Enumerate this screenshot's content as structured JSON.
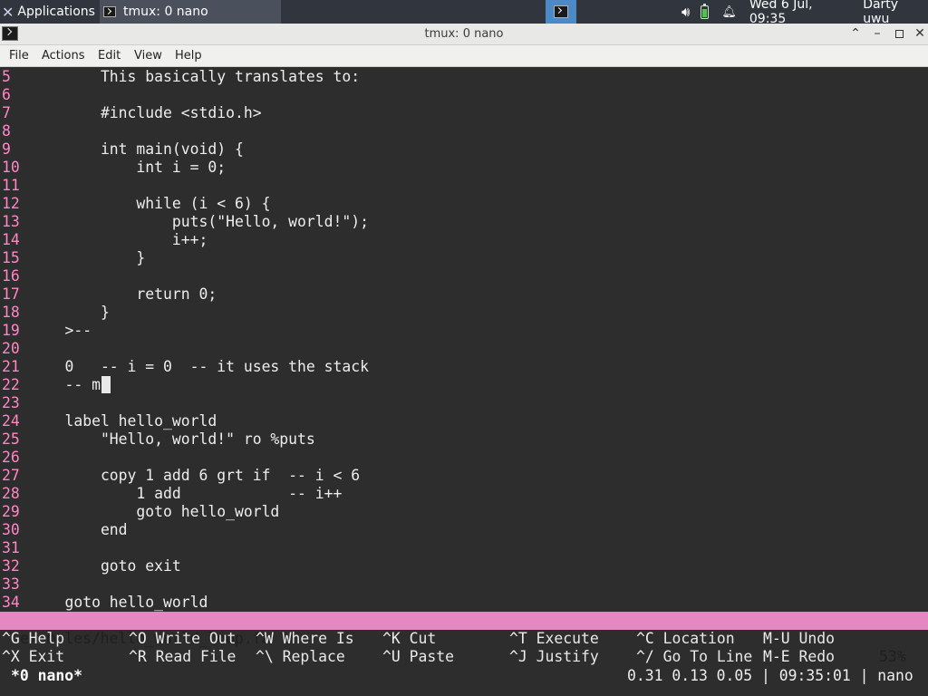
{
  "panel": {
    "applications_label": "Applications",
    "task_title": "tmux: 0 nano",
    "clock": "Wed  6 Jul, 09:35",
    "user": "Darty uwu"
  },
  "window": {
    "title": "tmux: 0 nano"
  },
  "menubar": {
    "file": "File",
    "actions": "Actions",
    "edit": "Edit",
    "view": "View",
    "help": "Help"
  },
  "editor": {
    "lines": [
      {
        "n": "5",
        "text": "        This basically translates to:"
      },
      {
        "n": "6",
        "text": ""
      },
      {
        "n": "7",
        "text": "        #include <stdio.h>"
      },
      {
        "n": "8",
        "text": ""
      },
      {
        "n": "9",
        "text": "        int main(void) {"
      },
      {
        "n": "10",
        "text": "            int i = 0;"
      },
      {
        "n": "11",
        "text": ""
      },
      {
        "n": "12",
        "text": "            while (i < 6) {"
      },
      {
        "n": "13",
        "text": "                puts(\"Hello, world!\");"
      },
      {
        "n": "14",
        "text": "                i++;"
      },
      {
        "n": "15",
        "text": "            }"
      },
      {
        "n": "16",
        "text": ""
      },
      {
        "n": "17",
        "text": "            return 0;"
      },
      {
        "n": "18",
        "text": "        }"
      },
      {
        "n": "19",
        "text": "    >--"
      },
      {
        "n": "20",
        "text": ""
      },
      {
        "n": "21",
        "text": "    0   -- i = 0  -- it uses the stack"
      },
      {
        "n": "22",
        "text": "    -- m"
      },
      {
        "n": "23",
        "text": ""
      },
      {
        "n": "24",
        "text": "    label hello_world"
      },
      {
        "n": "25",
        "text": "        \"Hello, world!\" ro %puts"
      },
      {
        "n": "26",
        "text": ""
      },
      {
        "n": "27",
        "text": "        copy 1 add 6 grt if  -- i < 6"
      },
      {
        "n": "28",
        "text": "            1 add            -- i++"
      },
      {
        "n": "29",
        "text": "            goto hello_world"
      },
      {
        "n": "30",
        "text": "        end"
      },
      {
        "n": "31",
        "text": ""
      },
      {
        "n": "32",
        "text": "        goto exit"
      },
      {
        "n": "33",
        "text": ""
      },
      {
        "n": "34",
        "text": "    goto hello_world"
      }
    ],
    "status_file": "examples/hello_world_loop.fa *",
    "status_percent": "53%"
  },
  "shortcuts": {
    "row1": [
      {
        "key": "^G",
        "label": "Help"
      },
      {
        "key": "^O",
        "label": "Write Out"
      },
      {
        "key": "^W",
        "label": "Where Is"
      },
      {
        "key": "^K",
        "label": "Cut"
      },
      {
        "key": "^T",
        "label": "Execute"
      },
      {
        "key": "^C",
        "label": "Location"
      },
      {
        "key": "M-U",
        "label": "Undo"
      }
    ],
    "row2": [
      {
        "key": "^X",
        "label": "Exit"
      },
      {
        "key": "^R",
        "label": "Read File"
      },
      {
        "key": "^\\",
        "label": "Replace"
      },
      {
        "key": "^U",
        "label": "Paste"
      },
      {
        "key": "^J",
        "label": "Justify"
      },
      {
        "key": "^/",
        "label": "Go To Line"
      },
      {
        "key": "M-E",
        "label": "Redo"
      }
    ]
  },
  "tmux": {
    "window_label": "*0 nano*",
    "status_right": "0.31 0.13 0.05 | 09:35:01 | nano"
  }
}
